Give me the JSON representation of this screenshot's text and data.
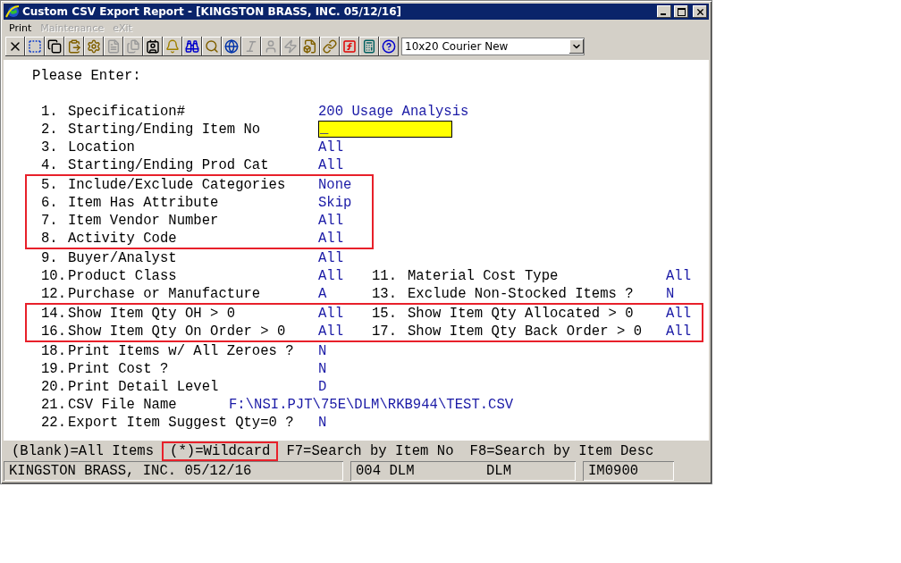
{
  "window": {
    "title": "Custom CSV Export Report - [KINGSTON BRASS, INC. 05/12/16]"
  },
  "menu": [
    {
      "label": "Print",
      "disabled": false
    },
    {
      "label": "Maintenance",
      "disabled": true
    },
    {
      "label": "eXit",
      "disabled": true
    }
  ],
  "toolbar": [
    {
      "kind": "close",
      "disabled": false
    },
    {
      "kind": "select",
      "disabled": false
    },
    {
      "kind": "copy",
      "disabled": false
    },
    {
      "kind": "paste",
      "disabled": false
    },
    {
      "kind": "gear",
      "disabled": false
    },
    {
      "kind": "form",
      "disabled": true
    },
    {
      "kind": "document",
      "disabled": true
    },
    {
      "kind": "contact",
      "disabled": false
    },
    {
      "kind": "bell",
      "disabled": false
    },
    {
      "kind": "binoculars",
      "disabled": false
    },
    {
      "kind": "search",
      "disabled": false
    },
    {
      "kind": "globe",
      "disabled": false
    },
    {
      "kind": "italic",
      "disabled": true
    },
    {
      "kind": "person",
      "disabled": true
    },
    {
      "kind": "lightning",
      "disabled": true
    },
    {
      "kind": "lightning-doc",
      "disabled": false
    },
    {
      "kind": "link",
      "disabled": false
    },
    {
      "kind": "function",
      "disabled": false
    },
    {
      "kind": "calculator",
      "disabled": false
    },
    {
      "kind": "help",
      "disabled": false
    }
  ],
  "font_select": {
    "value": "10x20 Courier New"
  },
  "prompt": "Please Enter:",
  "blocks": [
    {
      "boxed": false,
      "rows": [
        [
          {
            "number": "1.",
            "label": "Specification#",
            "value": "200 Usage Analysis",
            "kind": "text"
          }
        ],
        [
          {
            "number": "2.",
            "label": "Starting/Ending Item No",
            "value": "_",
            "kind": "input"
          }
        ],
        [
          {
            "number": "3.",
            "label": "Location",
            "value": "All",
            "kind": "text"
          }
        ],
        [
          {
            "number": "4.",
            "label": "Starting/Ending Prod Cat",
            "value": "All",
            "kind": "text"
          }
        ]
      ]
    },
    {
      "boxed": true,
      "rows": [
        [
          {
            "number": "5.",
            "label": "Include/Exclude Categories",
            "value": "None",
            "kind": "text"
          }
        ],
        [
          {
            "number": "6.",
            "label": "Item Has Attribute",
            "value": "Skip",
            "kind": "text"
          }
        ],
        [
          {
            "number": "7.",
            "label": "Item Vendor Number",
            "value": "All",
            "kind": "text"
          }
        ],
        [
          {
            "number": "8.",
            "label": "Activity Code",
            "value": "All",
            "kind": "text"
          }
        ]
      ]
    },
    {
      "boxed": false,
      "rows": [
        [
          {
            "number": "9.",
            "label": "Buyer/Analyst",
            "value": "All",
            "kind": "text"
          }
        ],
        [
          {
            "number": "10.",
            "label": "Product Class",
            "value": "All",
            "kind": "text"
          },
          {
            "number": "11.",
            "label": "Material Cost Type",
            "value": "All",
            "kind": "text"
          }
        ],
        [
          {
            "number": "12.",
            "label": "Purchase or Manufacture",
            "value": "A",
            "kind": "text"
          },
          {
            "number": "13.",
            "label": "Exclude Non-Stocked Items ?",
            "value": "N",
            "kind": "text"
          }
        ]
      ]
    },
    {
      "boxed": true,
      "rows": [
        [
          {
            "number": "14.",
            "label": "Show Item Qty OH > 0",
            "value": "All",
            "kind": "text"
          },
          {
            "number": "15.",
            "label": "Show Item Qty Allocated > 0",
            "value": "All",
            "kind": "text"
          }
        ],
        [
          {
            "number": "16.",
            "label": "Show Item Qty On Order > 0",
            "value": "All",
            "kind": "text"
          },
          {
            "number": "17.",
            "label": "Show Item Qty Back Order > 0",
            "value": "All",
            "kind": "text"
          }
        ]
      ]
    },
    {
      "boxed": false,
      "rows": [
        [
          {
            "number": "18.",
            "label": "Print Items w/ All Zeroes ?",
            "value": "N",
            "kind": "text"
          }
        ],
        [
          {
            "number": "19.",
            "label": "Print Cost ?",
            "value": "N",
            "kind": "text"
          }
        ],
        [
          {
            "number": "20.",
            "label": "Print Detail Level",
            "value": "D",
            "kind": "text"
          }
        ],
        [
          {
            "number": "21.",
            "label": "CSV File Name",
            "value": "F:\\NSI.PJT\\75E\\DLM\\RKB944\\TEST.CSV",
            "kind": "wide"
          }
        ],
        [
          {
            "number": "22.",
            "label": "Export Item Suggest Qty=0 ?",
            "value": "N",
            "kind": "text"
          }
        ]
      ]
    }
  ],
  "hint_bar": [
    {
      "text": "(Blank)=All Items",
      "boxed": false
    },
    {
      "text": "(*)=Wildcard",
      "boxed": true
    },
    {
      "text": "F7=Search by Item No",
      "boxed": false
    },
    {
      "text": "F8=Search by Item Desc",
      "boxed": false
    }
  ],
  "status_bar": [
    {
      "texts": [
        "KINGSTON BRASS, INC. 05/12/16"
      ]
    },
    {
      "texts": [
        "004 DLM",
        "DLM"
      ]
    },
    {
      "texts": [
        "IM0900"
      ]
    }
  ]
}
